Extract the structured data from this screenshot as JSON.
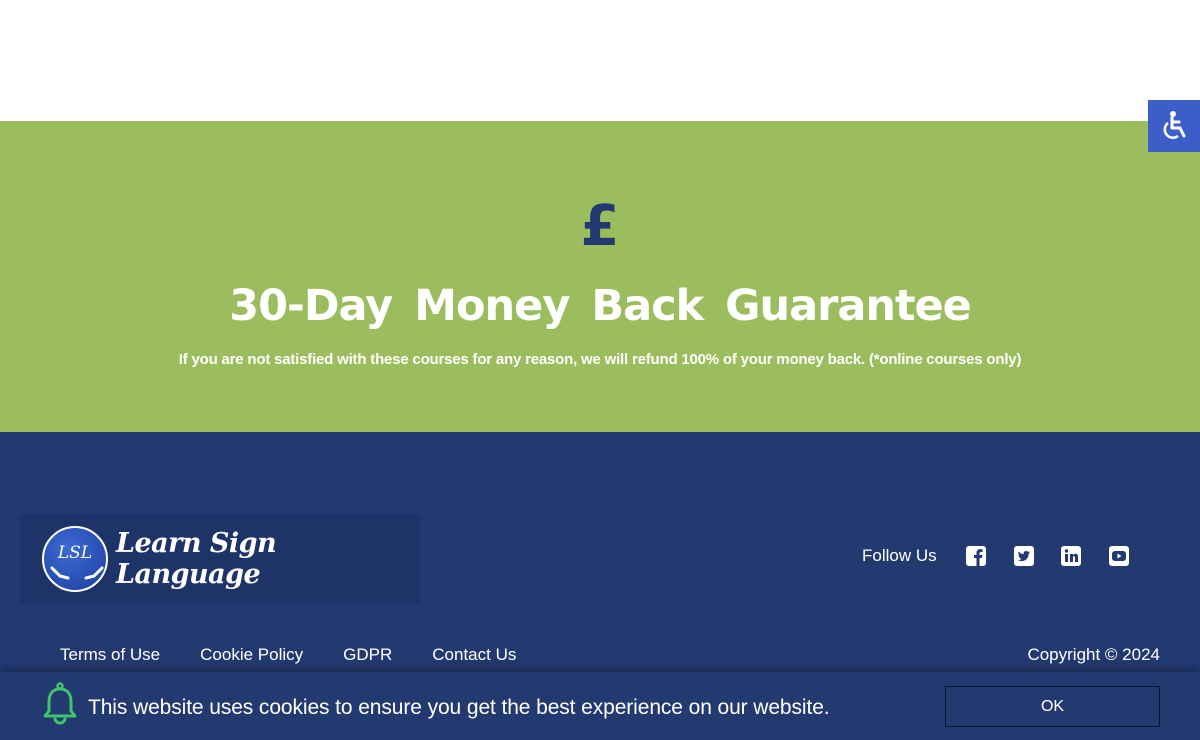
{
  "guarantee": {
    "icon": "pound-sign-icon",
    "title": "30-Day  Money  Back Guarantee",
    "text": "If you are not satisfied with these courses for any reason, we will refund 100% of your money back. (*online courses only)"
  },
  "logo": {
    "badge": "LSL",
    "name": "Learn Sign Language"
  },
  "footer": {
    "follow_label": "Follow Us",
    "social": [
      "facebook-icon",
      "twitter-icon",
      "linkedin-icon",
      "youtube-icon"
    ],
    "links": [
      "Terms of Use",
      "Cookie Policy",
      "GDPR",
      "Contact Us"
    ],
    "copyright": "Copyright © 2024"
  },
  "cookie": {
    "message": "This website uses cookies to ensure you get the best experience on our website.",
    "ok_label": "OK"
  },
  "colors": {
    "green": "#9bbd5e",
    "navy": "#223a70",
    "accessibility_blue": "#3d5ec9",
    "bell_green": "#3fc36b"
  }
}
